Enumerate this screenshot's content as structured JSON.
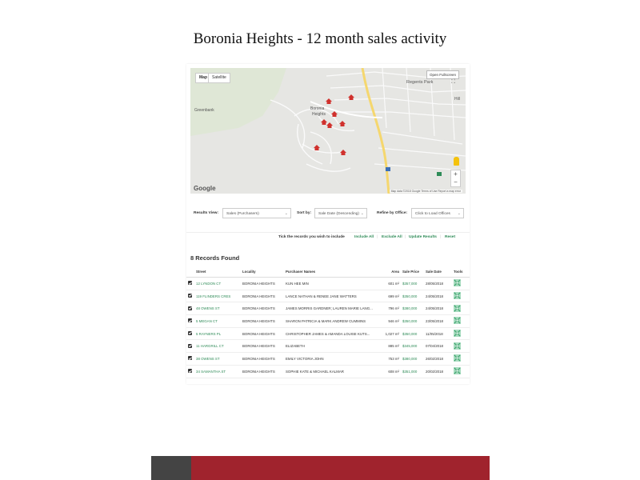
{
  "page": {
    "title": "Boronia Heights - 12 month sales activity"
  },
  "map": {
    "tab_map": "Map",
    "tab_satellite": "Satellite",
    "fullscreen_label": "Open Fullscreen",
    "labels": {
      "greenbank": "Greenbank",
      "boronia": "Boronia",
      "heights": "Heights",
      "regents_park": "Regents Park",
      "hill": "Hill"
    },
    "zoom_in": "+",
    "zoom_out": "−",
    "logo": "Google",
    "footer": "Map data ©2018 Google   Terms of Use   Report a map error",
    "marker_count": 8
  },
  "filters": {
    "results_view_label": "Results View:",
    "results_view_value": "Sales (Purchasers)",
    "sort_by_label": "Sort by:",
    "sort_by_value": "Sale Date (Descending)",
    "refine_label": "Refine by Office:",
    "refine_value": "Click to Load Offices"
  },
  "actions": {
    "prompt": "Tick the records you wish to include",
    "include_all": "Include All",
    "exclude_all": "Exclude All",
    "update_results": "Update Results",
    "reset": "Reset"
  },
  "records": {
    "count_text": "8 Records Found",
    "columns": [
      "Street",
      "Locality",
      "Purchaser Names",
      "Area",
      "Sale Price",
      "Sale Date",
      "Tools"
    ],
    "rows": [
      {
        "street": "12 LYNDON CT",
        "locality": "BORONIA HEIGHTS",
        "purchaser": "KUN HEE MIN",
        "area": "601 m²",
        "price": "$357,000",
        "date": "28/05/2018"
      },
      {
        "street": "119 FLINDERS CRES",
        "locality": "BORONIA HEIGHTS",
        "purchaser": "LANCE NATHAN & RENEE JANE WATTERS",
        "area": "699 m²",
        "price": "$350,000",
        "date": "24/05/2018"
      },
      {
        "street": "48 OWENS ST",
        "locality": "BORONIA HEIGHTS",
        "purchaser": "JAMES MORRIS GARDNER; LAUREN MARIE LANG...",
        "area": "796 m²",
        "price": "$380,000",
        "date": "24/05/2018"
      },
      {
        "street": "5 MEGAN CT",
        "locality": "BORONIA HEIGHTS",
        "purchaser": "SHARON PATRICIA & MARK ANDREW CUMMINS",
        "area": "946 m²",
        "price": "$350,000",
        "date": "23/05/2018"
      },
      {
        "street": "5 RAYNERS PL",
        "locality": "BORONIA HEIGHTS",
        "purchaser": "CHRISTOPHER JAMES & AMANDA LOUISE KUTS...",
        "area": "1,027 m²",
        "price": "$350,000",
        "date": "11/05/2018"
      },
      {
        "street": "11 HARGRILL CT",
        "locality": "BORONIA HEIGHTS",
        "purchaser": "ELIZABETH",
        "area": "885 m²",
        "price": "$345,000",
        "date": "07/04/2018"
      },
      {
        "street": "38 OWENS ST",
        "locality": "BORONIA HEIGHTS",
        "purchaser": "EMILY VICTORIA JOHN",
        "area": "753 m²",
        "price": "$380,000",
        "date": "26/02/2018"
      },
      {
        "street": "34 SAMANTHA ST",
        "locality": "BORONIA HEIGHTS",
        "purchaser": "SOPHIE KATE & MICHAEL KALMAR",
        "area": "608 m²",
        "price": "$351,000",
        "date": "20/02/2018"
      }
    ]
  },
  "colors": {
    "accent_green": "#2e8b57",
    "footer_red": "#a0232d",
    "footer_dark": "#444444",
    "marker_red": "#d0312d"
  }
}
